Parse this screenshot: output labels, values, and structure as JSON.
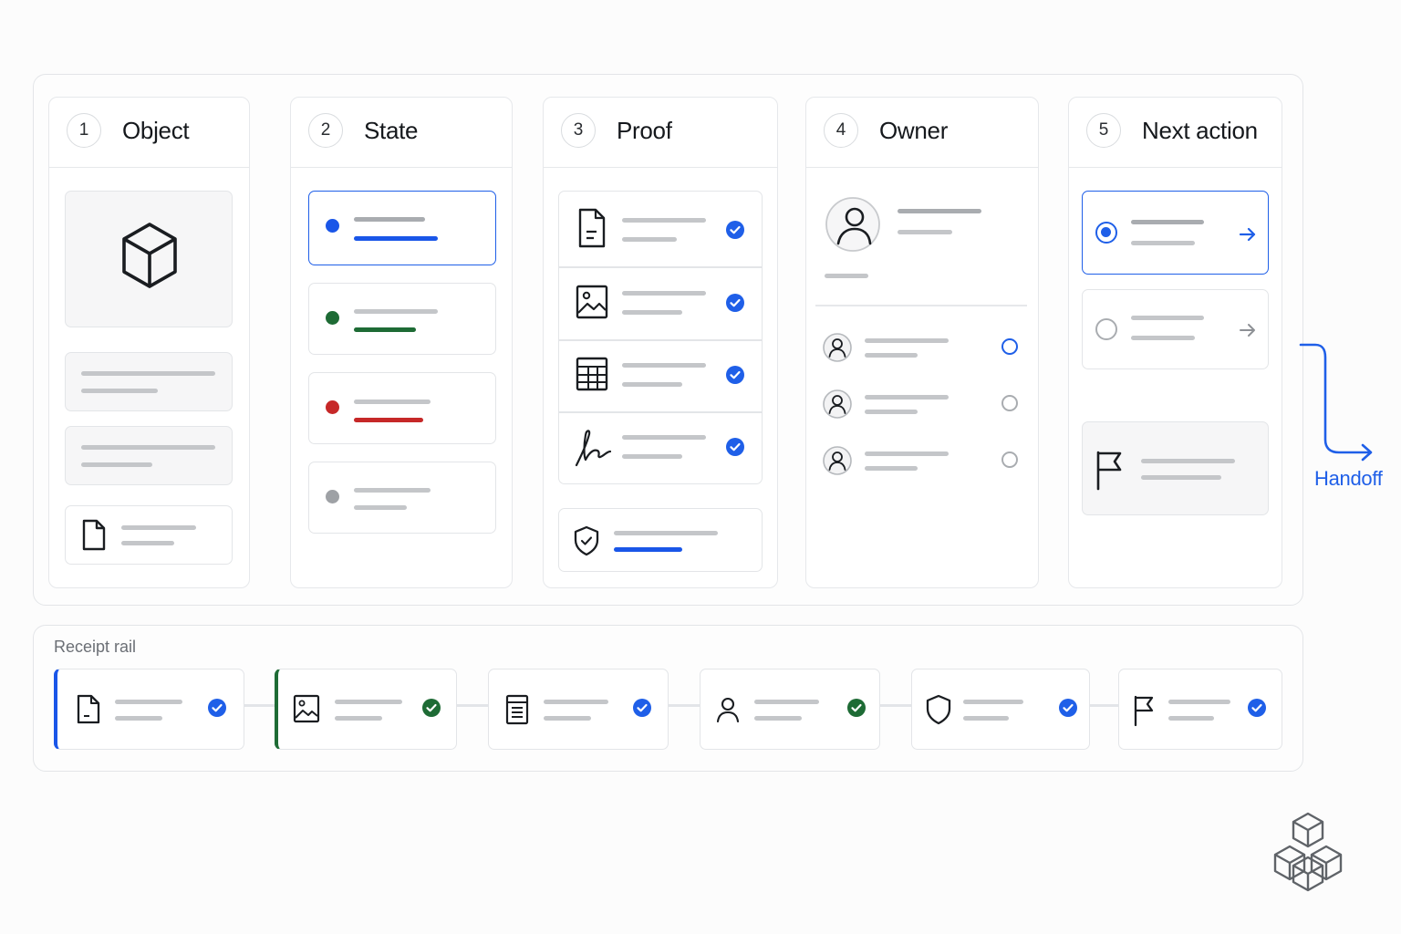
{
  "steps": [
    {
      "num": "1",
      "title": "Object"
    },
    {
      "num": "2",
      "title": "State"
    },
    {
      "num": "3",
      "title": "Proof"
    },
    {
      "num": "4",
      "title": "Owner"
    },
    {
      "num": "5",
      "title": "Next action"
    }
  ],
  "state_colors": [
    "#1a56e8",
    "#1e6b35",
    "#c62828",
    "#9ea1a5"
  ],
  "accent": "#1f5fe8",
  "handoff_label": "Handoff",
  "rail": {
    "label": "Receipt rail",
    "items": [
      {
        "icon": "document-icon",
        "check": "blue",
        "accent": "blue"
      },
      {
        "icon": "image-icon",
        "check": "green",
        "accent": "green"
      },
      {
        "icon": "form-icon",
        "check": "blue",
        "accent": "none"
      },
      {
        "icon": "user-icon",
        "check": "green",
        "accent": "none"
      },
      {
        "icon": "shield-icon",
        "check": "blue",
        "accent": "none"
      },
      {
        "icon": "flag-icon",
        "check": "blue",
        "accent": "none"
      }
    ]
  },
  "logo": "stacked-cubes-icon"
}
